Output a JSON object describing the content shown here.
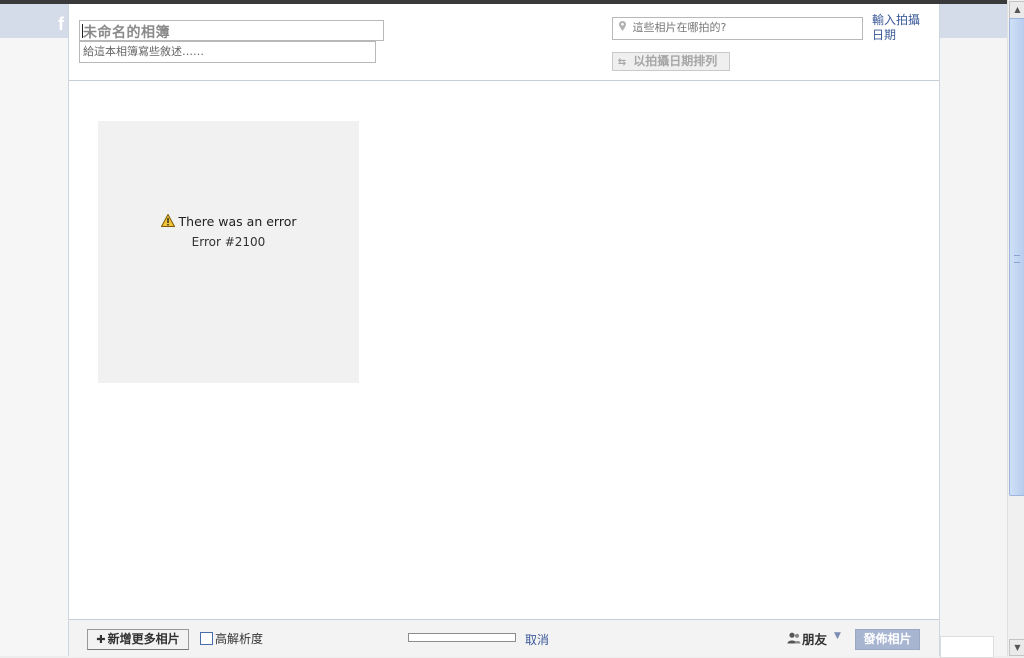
{
  "background": {
    "logo_letter": "f"
  },
  "header": {
    "album_title_placeholder": "未命名的相簿",
    "description_placeholder": "給這本相簿寫些敘述……",
    "location_placeholder": "這些相片在哪拍的?",
    "date_link": "輸入拍攝日期",
    "sort_button": "以拍攝日期排列",
    "icons": {
      "location": "pin-icon",
      "sort": "swap-arrows-icon"
    }
  },
  "photo": {
    "error_title": "There was an error",
    "error_code": "Error #2100",
    "icon": "warning-icon",
    "warning_color": "#f0c23a"
  },
  "footer": {
    "add_more_label": "新增更多相片",
    "hires_label": "高解析度",
    "hires_checked": false,
    "upload_progress": 0,
    "cancel_label": "取消",
    "privacy_label": "朋友",
    "publish_label": "發佈相片",
    "link_color": "#3b5998",
    "publish_color": "#a8b5d1"
  }
}
